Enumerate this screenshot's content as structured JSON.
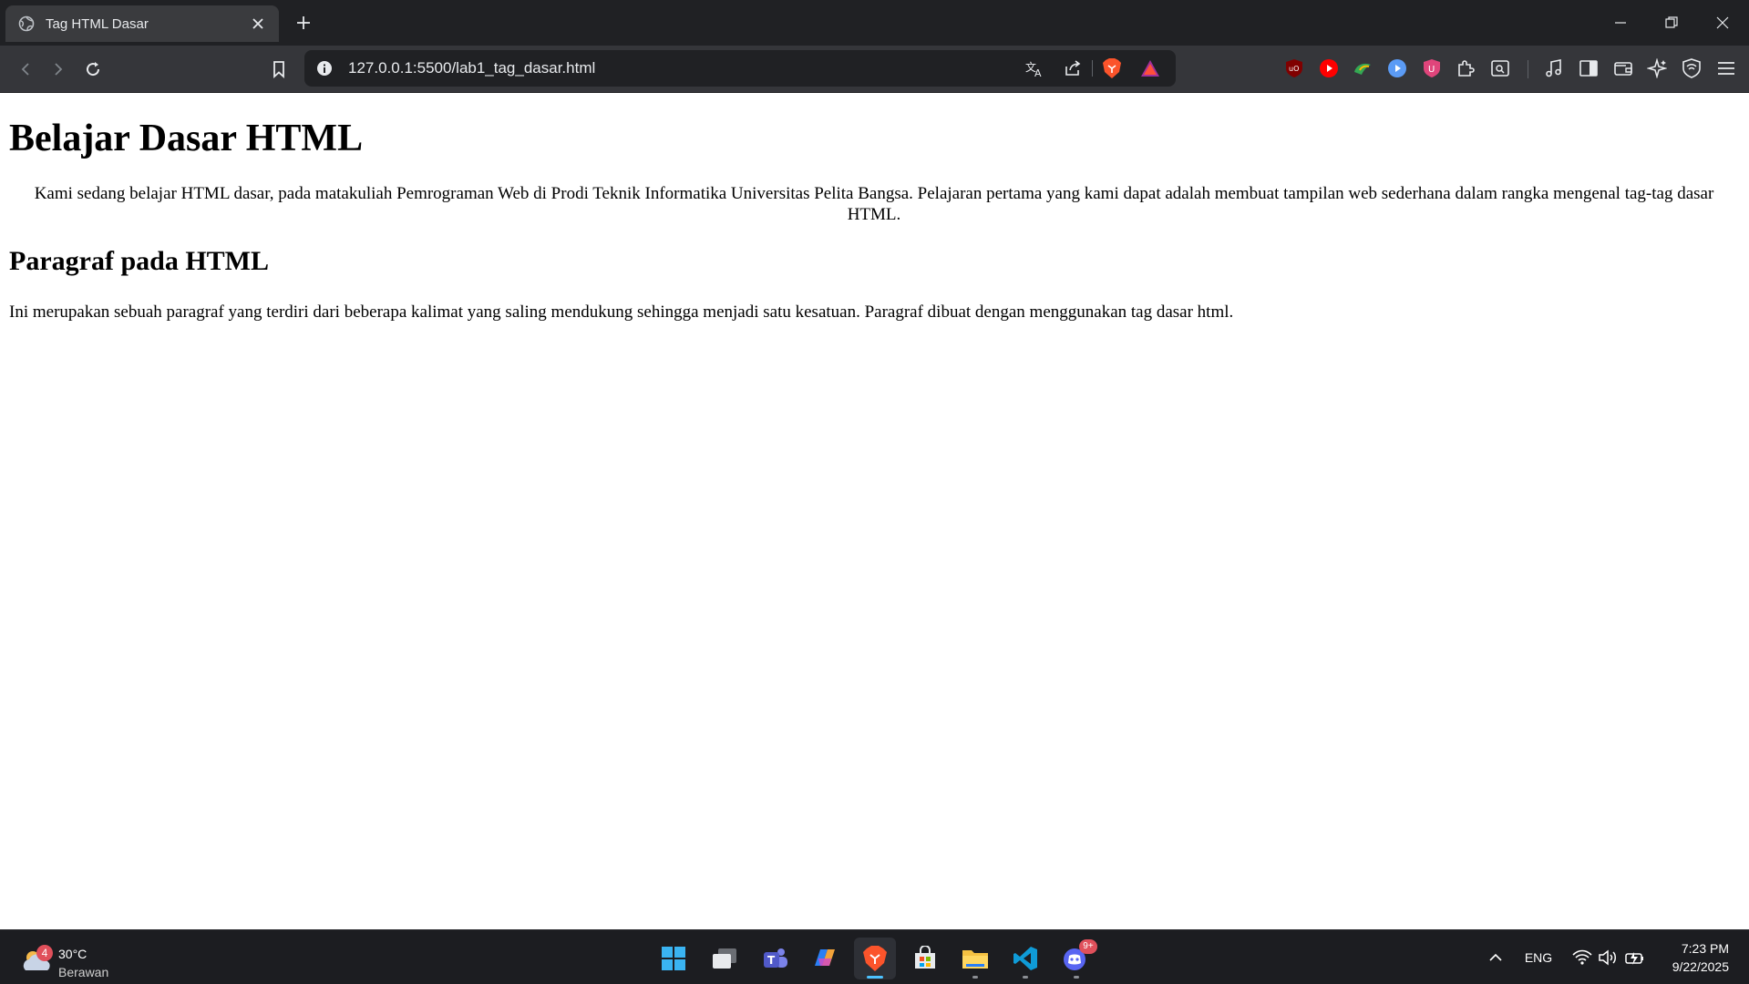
{
  "browser": {
    "tab_title": "Tag HTML Dasar",
    "url": "127.0.0.1:5500/lab1_tag_dasar.html"
  },
  "page": {
    "heading": "Belajar Dasar HTML",
    "intro": "Kami sedang belajar HTML dasar, pada matakuliah Pemrograman Web di Prodi Teknik Informatika Universitas Pelita Bangsa. Pelajaran pertama yang kami dapat adalah membuat tampilan web sederhana dalam rangka mengenal tag-tag dasar HTML.",
    "subheading": "Paragraf pada HTML",
    "paragraph": "Ini merupakan sebuah paragraf yang terdiri dari beberapa kalimat yang saling mendukung sehingga menjadi satu kesatuan. Paragraf dibuat dengan menggunakan tag dasar html."
  },
  "taskbar": {
    "weather_temp": "30°C",
    "weather_condition": "Berawan",
    "weather_badge": "4",
    "language": "ENG",
    "time": "7:23 PM",
    "date": "9/22/2025",
    "discord_badge": "9+"
  },
  "colors": {
    "titlebar_bg": "#202124",
    "toolbar_bg": "#35363a",
    "taskbar_bg": "#1c1d21",
    "brave_orange": "#fb542b",
    "vscode_blue": "#0f9bd7",
    "discord_blurple": "#5865f2"
  }
}
